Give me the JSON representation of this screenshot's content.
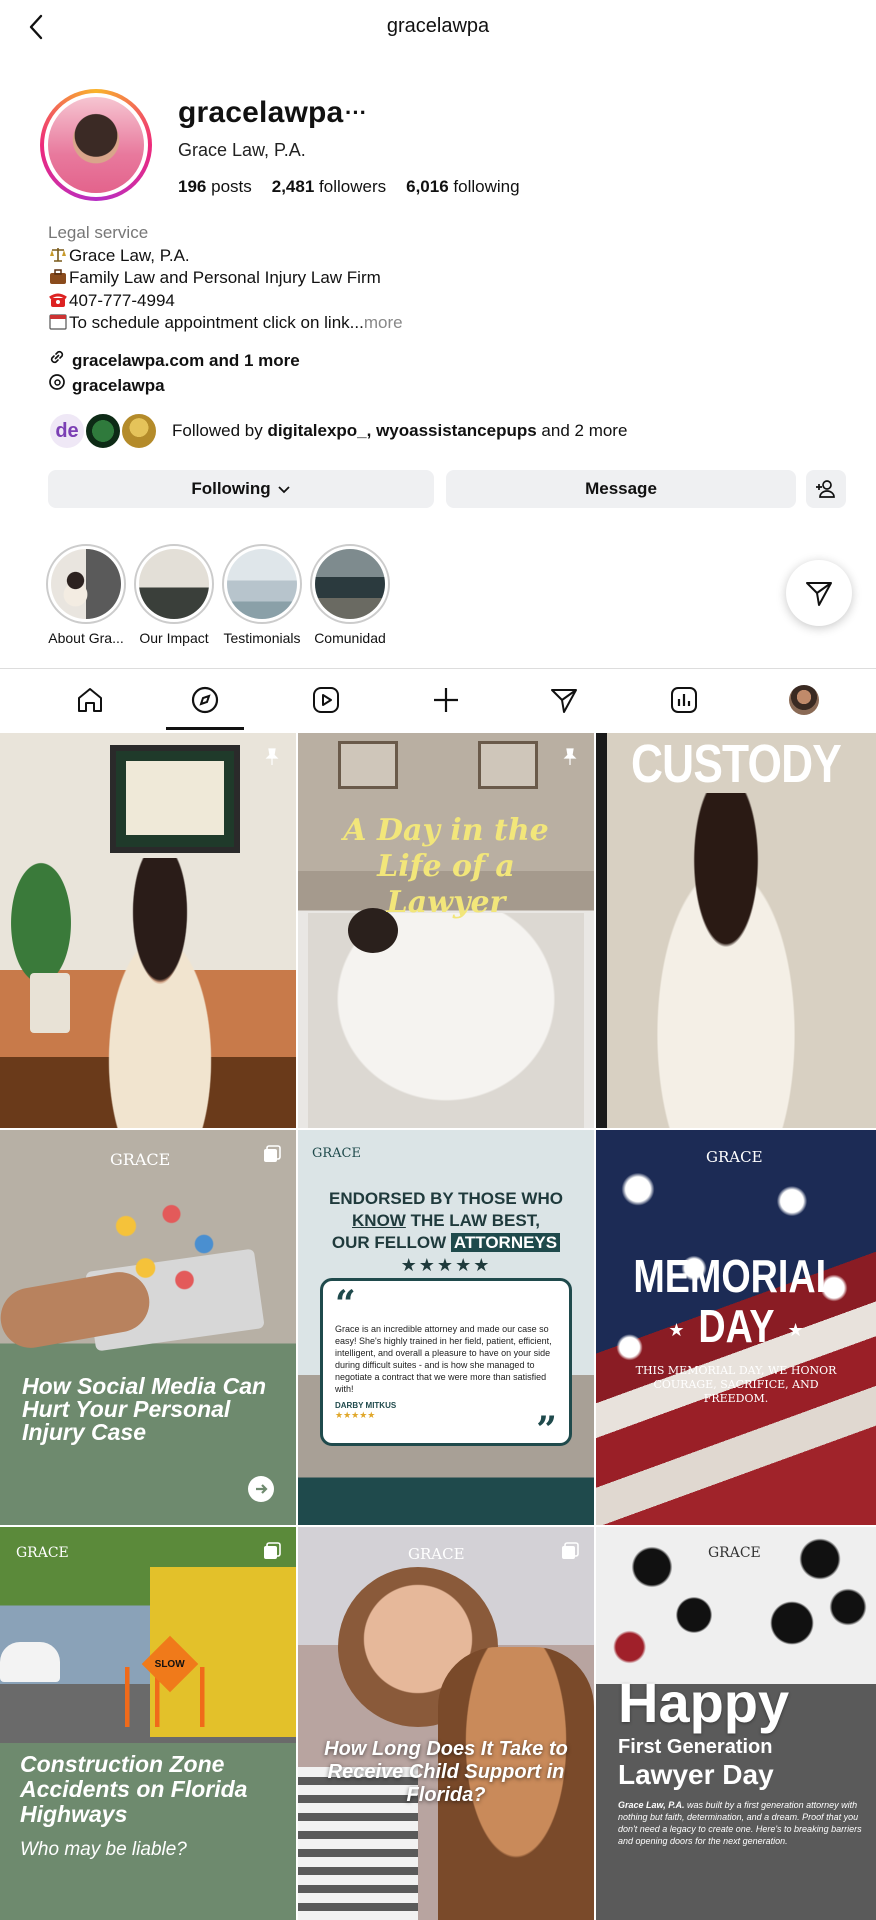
{
  "topbar": {
    "title": "gracelawpa"
  },
  "profile": {
    "username": "gracelawpa",
    "more": "···",
    "full_name": "Grace Law, P.A.",
    "posts_count": "196",
    "posts_label": "posts",
    "followers_count": "2,481",
    "followers_label": "followers",
    "following_count": "6,016",
    "following_label": "following"
  },
  "bio": {
    "category": "Legal service",
    "line1": "Grace Law, P.A.",
    "line2": "Family Law and Personal Injury Law Firm",
    "line3": "407-777-4994",
    "line4": "To schedule appointment click on link...",
    "more": " more",
    "icons": [
      "scales-emoji",
      "briefcase-emoji",
      "telephone-emoji",
      "calendar-emoji"
    ]
  },
  "links": {
    "website": "gracelawpa.com and 1 more",
    "threads": "gracelawpa"
  },
  "followed_by": {
    "prefix": "Followed by ",
    "users": "digitalexpo_, wyoassistancepups",
    "suffix": " and 2 more"
  },
  "actions": {
    "following": "Following",
    "message": "Message"
  },
  "highlights": [
    {
      "label": "About Gra..."
    },
    {
      "label": "Our Impact"
    },
    {
      "label": "Testimonials"
    },
    {
      "label": "Comunidad"
    }
  ],
  "nav": [
    "home-icon",
    "explore-icon",
    "reels-icon",
    "create-icon",
    "messages-icon",
    "insights-icon",
    "profile-icon"
  ],
  "posts": {
    "p1": {
      "pinned": true
    },
    "p2": {
      "title": "A Day in the Life of a Lawyer",
      "pinned": true
    },
    "p3": {
      "title": "CUSTODY"
    },
    "p4": {
      "logo": "GRACE",
      "title": "How Social Media Can Hurt Your Personal Injury Case"
    },
    "p5": {
      "logo": "GRACE",
      "h1": "ENDORSED BY THOSE WHO",
      "h2a": "KNOW",
      "h2b": " THE LAW BEST,",
      "h3a": "OUR FELLOW ",
      "h3b": "ATTORNEYS",
      "stars": "★★★★★",
      "quote": "Grace is an incredible attorney and made our case so easy! She's highly trained in her field, patient, efficient, intelligent, and overall a pleasure to have on your side during difficult suites - and is how she managed to negotiate a contract that we were more than satisfied with!",
      "author": "DARBY MITKUS",
      "author_stars": "★★★★★"
    },
    "p6": {
      "logo": "GRACE",
      "title1": "MEMORIAL",
      "title2": "DAY",
      "subtitle": "THIS MEMORIAL DAY, WE HONOR COURAGE, SACRIFICE, AND FREEDOM."
    },
    "p7": {
      "logo": "GRACE",
      "title": "Construction Zone Accidents on Florida Highways",
      "subtitle": "Who may be liable?",
      "sign": "SLOW"
    },
    "p8": {
      "logo": "GRACE",
      "title": "How Long Does It Take to Receive Child Support in Florida?"
    },
    "p9": {
      "logo": "GRACE",
      "title1": "Happy",
      "title2": "First Generation",
      "title3": "Lawyer Day",
      "body_bold": "Grace Law, P.A.",
      "body": " was built by a first generation attorney with nothing but faith, determination, and a dream. Proof that you don't need a legacy to create one. Here's to breaking barriers and opening doors for the next generation."
    }
  },
  "colors": {
    "accent_green": "#6e8a6e",
    "teal": "#1f4a4c",
    "ring_orange": "#f9b42a",
    "ring_pink": "#ee2a7b"
  }
}
